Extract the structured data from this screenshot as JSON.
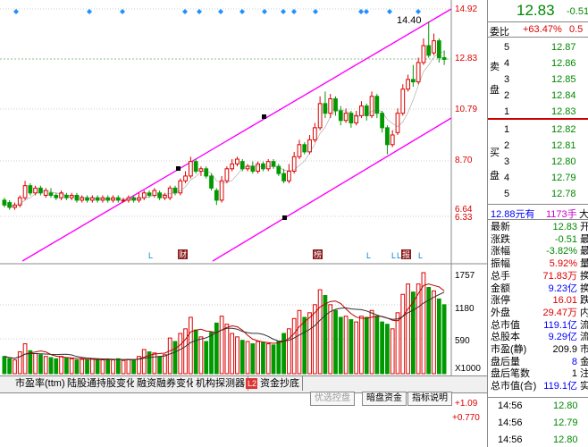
{
  "chart_data": {
    "type": "candlestick",
    "price_axis_ticks": [
      "14.92",
      "12.83",
      "10.79",
      "8.70",
      "6.64",
      "6.33"
    ],
    "high_label": "14.40",
    "volume_axis_ticks": [
      "1757",
      "1180",
      "590"
    ],
    "volume_unit": "X1000",
    "macd_axis_ticks": [
      "+1.09",
      "+0.770"
    ],
    "candles": [
      [
        7.0,
        6.8,
        7.1,
        6.7
      ],
      [
        6.9,
        6.7,
        7.0,
        6.6
      ],
      [
        6.7,
        6.8,
        6.9,
        6.6
      ],
      [
        6.8,
        7.1,
        7.2,
        6.7
      ],
      [
        7.1,
        7.6,
        7.8,
        7.0
      ],
      [
        7.6,
        7.3,
        7.7,
        7.2
      ],
      [
        7.3,
        7.5,
        7.6,
        7.2
      ],
      [
        7.5,
        7.3,
        7.6,
        7.2
      ],
      [
        7.2,
        7.4,
        7.5,
        7.1
      ],
      [
        7.3,
        7.2,
        7.5,
        7.1
      ],
      [
        7.2,
        7.1,
        7.3,
        7.0
      ],
      [
        7.1,
        7.3,
        7.4,
        7.0
      ],
      [
        7.2,
        7.1,
        7.3,
        7.0
      ],
      [
        7.1,
        7.2,
        7.3,
        7.0
      ],
      [
        7.2,
        7.0,
        7.3,
        6.9
      ],
      [
        7.0,
        7.1,
        7.2,
        6.9
      ],
      [
        7.1,
        7.0,
        7.2,
        6.9
      ],
      [
        7.0,
        7.1,
        7.2,
        6.9
      ],
      [
        7.1,
        7.0,
        7.2,
        6.9
      ],
      [
        7.0,
        7.1,
        7.2,
        6.9
      ],
      [
        7.1,
        7.0,
        7.2,
        6.9
      ],
      [
        7.0,
        7.1,
        7.2,
        6.9
      ],
      [
        7.1,
        7.0,
        7.2,
        6.9
      ],
      [
        7.0,
        7.0,
        7.1,
        6.9
      ],
      [
        7.0,
        7.1,
        7.2,
        6.9
      ],
      [
        7.1,
        7.0,
        7.2,
        6.9
      ],
      [
        7.0,
        7.1,
        7.3,
        6.9
      ],
      [
        7.1,
        7.3,
        7.4,
        7.0
      ],
      [
        7.3,
        7.2,
        7.4,
        7.1
      ],
      [
        7.2,
        7.4,
        7.5,
        7.1
      ],
      [
        7.3,
        7.1,
        7.4,
        7.0
      ],
      [
        7.1,
        7.2,
        7.3,
        7.0
      ],
      [
        7.1,
        7.5,
        7.6,
        7.0
      ],
      [
        7.5,
        7.3,
        7.6,
        7.2
      ],
      [
        7.3,
        7.8,
        7.9,
        7.2
      ],
      [
        7.8,
        8.0,
        8.2,
        7.7
      ],
      [
        8.0,
        8.6,
        8.8,
        7.9
      ],
      [
        8.6,
        8.2,
        8.7,
        8.1
      ],
      [
        8.2,
        8.3,
        8.4,
        8.0
      ],
      [
        8.3,
        8.0,
        8.4,
        7.9
      ],
      [
        8.0,
        7.5,
        8.1,
        7.4
      ],
      [
        7.4,
        7.0,
        7.5,
        6.8
      ],
      [
        7.0,
        7.8,
        8.0,
        6.9
      ],
      [
        7.8,
        8.3,
        8.4,
        7.7
      ],
      [
        8.3,
        8.5,
        8.7,
        8.2
      ],
      [
        8.5,
        8.7,
        8.8,
        8.4
      ],
      [
        8.6,
        8.3,
        8.7,
        8.2
      ],
      [
        8.3,
        8.4,
        8.5,
        8.2
      ],
      [
        8.4,
        8.2,
        8.6,
        8.1
      ],
      [
        8.2,
        8.5,
        8.6,
        8.1
      ],
      [
        8.5,
        8.3,
        8.6,
        8.2
      ],
      [
        8.3,
        8.6,
        8.7,
        8.2
      ],
      [
        8.6,
        8.4,
        8.7,
        8.3
      ],
      [
        8.4,
        8.1,
        8.5,
        8.0
      ],
      [
        8.1,
        7.8,
        8.3,
        7.7
      ],
      [
        7.8,
        8.2,
        8.5,
        7.7
      ],
      [
        8.2,
        8.8,
        9.0,
        8.1
      ],
      [
        8.8,
        9.3,
        9.5,
        8.7
      ],
      [
        9.3,
        9.0,
        9.4,
        8.9
      ],
      [
        9.0,
        9.5,
        9.7,
        8.9
      ],
      [
        9.5,
        10.0,
        10.2,
        9.4
      ],
      [
        10.0,
        11.0,
        11.3,
        9.9
      ],
      [
        11.0,
        10.6,
        11.5,
        10.4
      ],
      [
        10.6,
        11.2,
        11.4,
        10.4
      ],
      [
        11.2,
        10.7,
        11.3,
        10.5
      ],
      [
        10.7,
        10.3,
        10.9,
        10.1
      ],
      [
        10.3,
        10.6,
        10.8,
        10.2
      ],
      [
        10.6,
        10.2,
        10.7,
        10.0
      ],
      [
        10.2,
        10.5,
        10.7,
        10.1
      ],
      [
        10.5,
        10.9,
        11.1,
        10.4
      ],
      [
        10.9,
        10.5,
        11.0,
        10.3
      ],
      [
        10.5,
        11.3,
        11.5,
        10.4
      ],
      [
        11.3,
        10.6,
        11.4,
        10.4
      ],
      [
        10.6,
        10.0,
        10.7,
        9.8
      ],
      [
        10.0,
        9.3,
        10.1,
        8.9
      ],
      [
        9.3,
        9.7,
        9.9,
        9.2
      ],
      [
        9.8,
        10.6,
        10.8,
        9.7
      ],
      [
        10.6,
        11.6,
        11.8,
        10.5
      ],
      [
        11.6,
        12.0,
        12.2,
        11.5
      ],
      [
        12.0,
        11.9,
        12.6,
        11.7
      ],
      [
        11.9,
        12.7,
        12.9,
        11.8
      ],
      [
        12.7,
        13.4,
        13.7,
        12.6
      ],
      [
        13.4,
        13.0,
        14.4,
        12.9
      ],
      [
        13.1,
        13.6,
        13.9,
        13.0
      ],
      [
        13.6,
        12.9,
        13.7,
        12.7
      ],
      [
        12.9,
        12.83,
        13.2,
        12.6
      ]
    ],
    "volumes": [
      300,
      260,
      240,
      380,
      520,
      400,
      350,
      330,
      300,
      280,
      260,
      300,
      270,
      260,
      240,
      250,
      240,
      260,
      250,
      240,
      250,
      240,
      260,
      230,
      250,
      240,
      300,
      420,
      380,
      360,
      300,
      330,
      620,
      560,
      700,
      780,
      980,
      760,
      640,
      560,
      720,
      880,
      1000,
      860,
      700,
      640,
      580,
      560,
      520,
      560,
      540,
      520,
      500,
      560,
      700,
      780,
      960,
      1100,
      980,
      1060,
      1200,
      1460,
      1360,
      1200,
      1100,
      980,
      1000,
      940,
      900,
      1000,
      980,
      1100,
      1000,
      900,
      860,
      780,
      1060,
      1380,
      1560,
      1420,
      1560,
      1757,
      1500,
      1440,
      1300,
      1200
    ],
    "markers": [
      "L",
      "财",
      "榜",
      "L",
      "L",
      "L",
      "报",
      "L"
    ]
  },
  "left_tabs": [
    "市盈率(ttm)",
    "陆股通持股变化",
    "融资融券变化",
    "机构探测器",
    "资金抄底"
  ],
  "left_tab_badge": "L2",
  "bottom_tabs": [
    "优选控盘",
    "暗盘资金",
    "指标说明"
  ],
  "quote": {
    "price": "12.83",
    "change": "-0.51",
    "weibi_label": "委比",
    "weibi_value": "+63.47%",
    "weibi_extra": "0.5",
    "sell_label": "卖盘",
    "buy_label": "买盘",
    "sell_rows": [
      [
        "5",
        "12.87"
      ],
      [
        "4",
        "12.86"
      ],
      [
        "3",
        "12.85"
      ],
      [
        "2",
        "12.84"
      ],
      [
        "1",
        "12.83"
      ]
    ],
    "buy_rows": [
      [
        "1",
        "12.82"
      ],
      [
        "2",
        "12.81"
      ],
      [
        "3",
        "12.80"
      ],
      [
        "4",
        "12.79"
      ],
      [
        "5",
        "12.78"
      ]
    ],
    "last_trade_price": "12.88元有",
    "last_trade_vol": "1173手",
    "last_trade_tail": "大",
    "stats": [
      [
        "最新",
        "12.83",
        "开"
      ],
      [
        "涨跌",
        "-0.51",
        "最"
      ],
      [
        "涨幅",
        "-3.82%",
        "最"
      ],
      [
        "振幅",
        "5.92%",
        "量"
      ],
      [
        "总手",
        "71.83万",
        "换"
      ],
      [
        "金额",
        "9.23亿",
        "换"
      ],
      [
        "涨停",
        "16.01",
        "跌"
      ],
      [
        "外盘",
        "29.47万",
        "内"
      ],
      [
        "总市值",
        "119.1亿",
        "流"
      ],
      [
        "总股本",
        "9.29亿",
        "流"
      ],
      [
        "市盈(静)",
        "209.9",
        "市"
      ],
      [
        "盘后量",
        "8",
        "金"
      ],
      [
        "盘后笔数",
        "1",
        "注"
      ],
      [
        "总市值(合)",
        "119.1亿",
        "实"
      ]
    ],
    "ticks": [
      [
        "14:56",
        "12.80"
      ],
      [
        "14:56",
        "12.79"
      ],
      [
        "14:56",
        "12.80"
      ]
    ]
  }
}
